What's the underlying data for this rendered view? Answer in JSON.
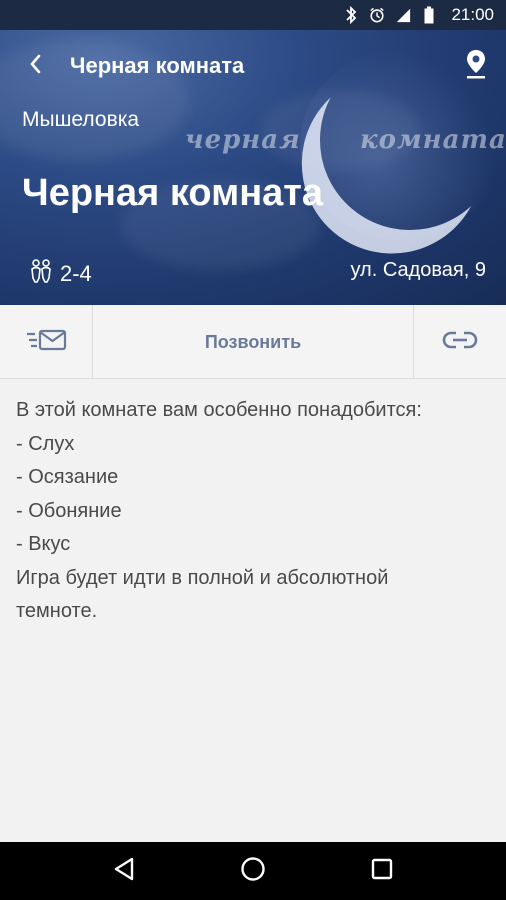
{
  "status": {
    "time": "21:00"
  },
  "topbar": {
    "title": "Черная комната"
  },
  "hero": {
    "org": "Мышеловка",
    "title": "Черная комната",
    "players": "2-4",
    "address": "ул. Садовая, 9",
    "logo_words": [
      "черная",
      "комната"
    ]
  },
  "actions": {
    "call_label": "Позвонить"
  },
  "description": [
    "В этой комнате вам особенно понадобится:",
    "- Слух",
    "- Осязание",
    "- Обоняние",
    "- Вкус",
    "Игра будет идти в полной и абсолютной",
    "темноте."
  ],
  "colors": {
    "hero": "#2c4a85",
    "accent": "#6a7b99",
    "text": "#4a4a4a"
  }
}
